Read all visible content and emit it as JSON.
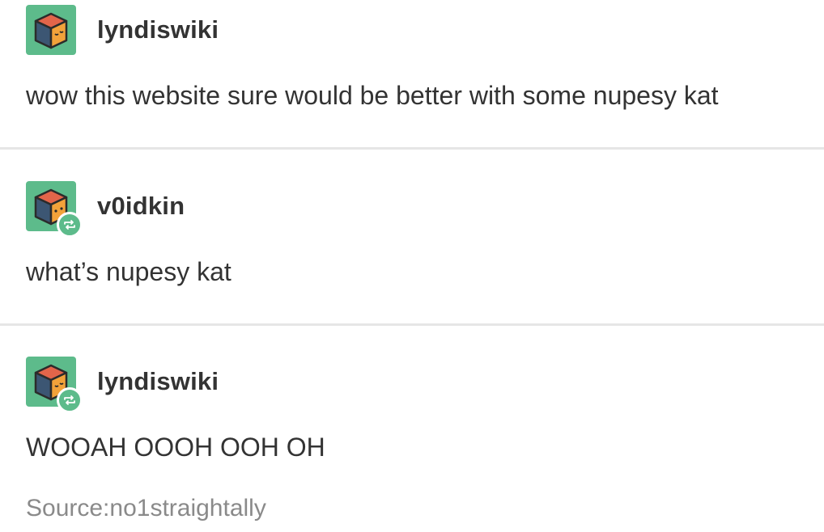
{
  "posts": [
    {
      "username": "lyndiswiki",
      "text": "wow this website sure would be better with some nupesy kat",
      "avatar_icon": "cube-avatar-icon",
      "reblog": false
    },
    {
      "username": "v0idkin",
      "text": "what’s nupesy kat",
      "avatar_icon": "cube-avatar-icon",
      "reblog": true
    },
    {
      "username": "lyndiswiki",
      "text": "WOOAH OOOH OOH OH",
      "avatar_icon": "cube-avatar-icon",
      "reblog": true
    }
  ],
  "source": {
    "label": "Source:",
    "name": "no1straightally"
  },
  "colors": {
    "avatar_bg": "#5dbb8b",
    "text": "#333333",
    "source_text": "#8a8a8a",
    "divider": "#e6e6e6",
    "cube_top": "#e2654a",
    "cube_left": "#3c5673",
    "cube_right": "#f2a23a"
  }
}
